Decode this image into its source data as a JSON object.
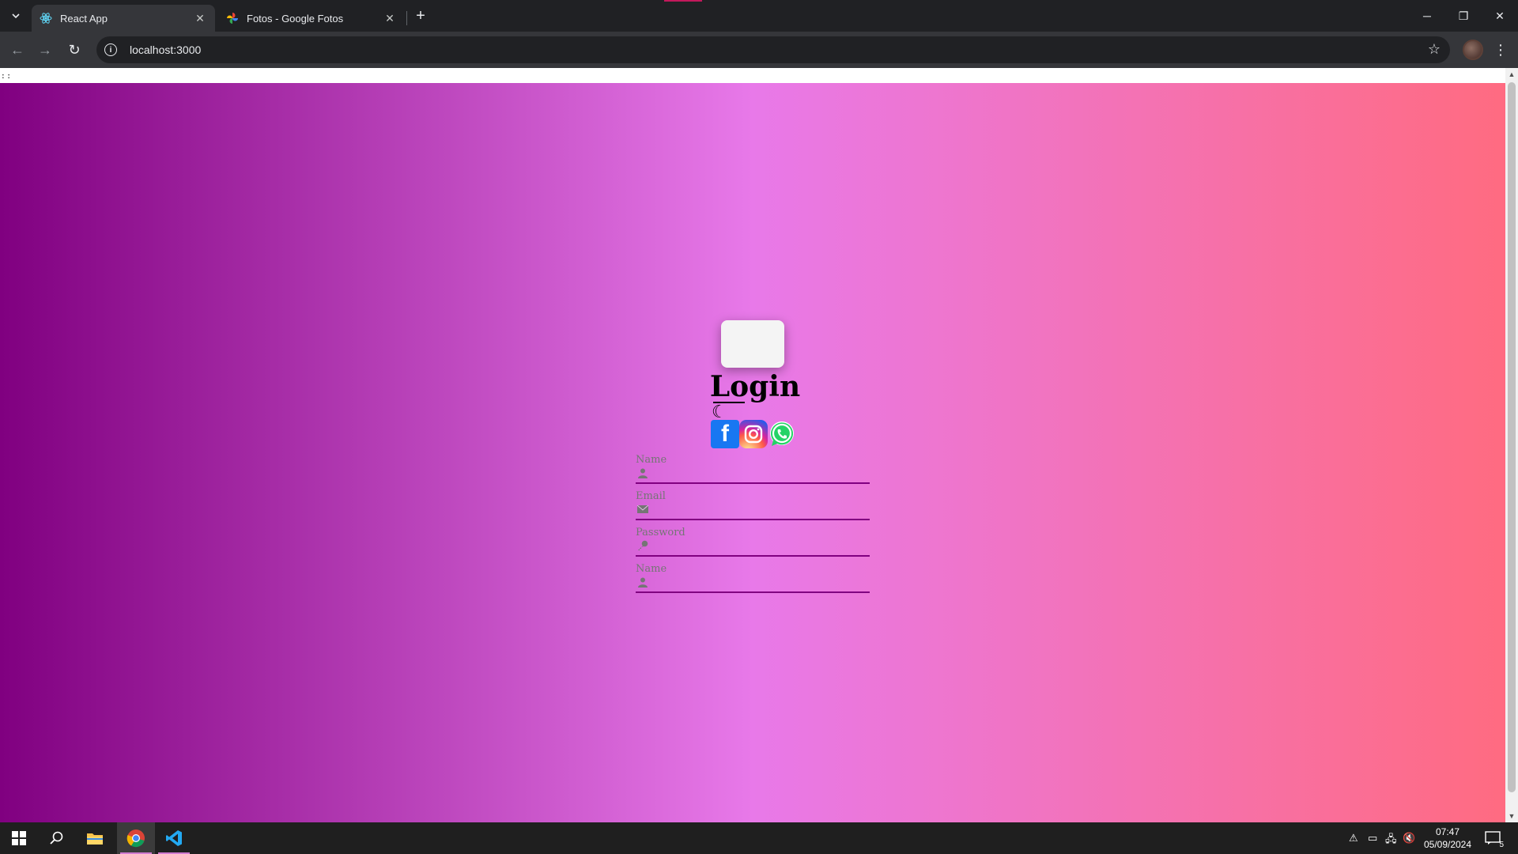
{
  "browser": {
    "tabs": [
      {
        "title": "React App",
        "active": true
      },
      {
        "title": "Fotos - Google Fotos",
        "active": false
      }
    ],
    "address": "localhost:3000"
  },
  "page": {
    "top_text": ": :",
    "title": "Login",
    "moon_glyph": "☾",
    "social": [
      "facebook",
      "instagram",
      "whatsapp"
    ],
    "fields": [
      {
        "label": "Name",
        "icon": "user-icon"
      },
      {
        "label": "Email",
        "icon": "envelope-icon"
      },
      {
        "label": "Password",
        "icon": "key-icon"
      },
      {
        "label": "Name",
        "icon": "user-icon"
      }
    ],
    "gradient_colors": [
      "#800080",
      "#e879e9",
      "#ff6b81"
    ]
  },
  "taskbar": {
    "time": "07:47",
    "date": "05/09/2024",
    "notifications": "5"
  }
}
